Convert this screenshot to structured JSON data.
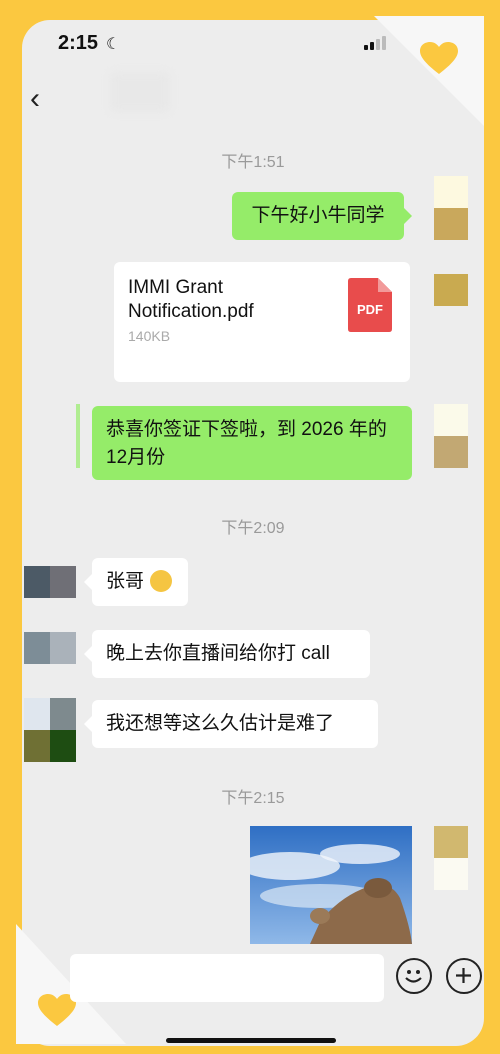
{
  "status_bar": {
    "time": "2:15"
  },
  "chat": {
    "timestamps": [
      "下午1:51",
      "下午2:09",
      "下午2:15"
    ],
    "messages": {
      "greeting": "下午好小牛同学",
      "file_name": "IMMI Grant Notification.pdf",
      "file_size": "140KB",
      "file_badge": "PDF",
      "congrats": "恭喜你签证下签啦，到 2026 年的12月份",
      "zhangge": "张哥",
      "call": "晚上去你直播间给你打 call",
      "hard": "我还想等这么久估计是难了"
    }
  },
  "icons": {
    "back": "chevron-left-icon",
    "moon": "moon-icon",
    "emoji": "emoji-icon",
    "plus": "plus-icon",
    "heart": "heart-icon"
  },
  "colors": {
    "frame": "#fbc840",
    "sent_bubble": "#95ec69",
    "received_bubble": "#ffffff",
    "pdf_red": "#e84c4c"
  }
}
